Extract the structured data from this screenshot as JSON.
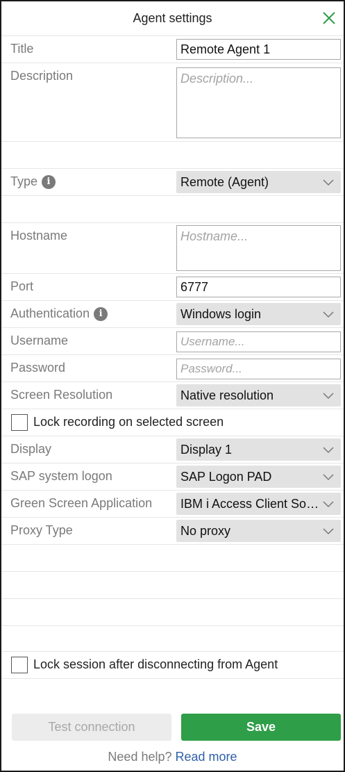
{
  "header": {
    "title": "Agent settings",
    "close_icon": "close-icon"
  },
  "fields": {
    "title": {
      "label": "Title",
      "value": "Remote Agent 1"
    },
    "description": {
      "label": "Description",
      "placeholder": "Description..."
    },
    "type": {
      "label": "Type",
      "value": "Remote (Agent)"
    },
    "hostname": {
      "label": "Hostname",
      "placeholder": "Hostname..."
    },
    "port": {
      "label": "Port",
      "value": "6777"
    },
    "authentication": {
      "label": "Authentication",
      "value": "Windows login"
    },
    "username": {
      "label": "Username",
      "placeholder": "Username..."
    },
    "password": {
      "label": "Password",
      "placeholder": "Password..."
    },
    "screen_resolution": {
      "label": "Screen Resolution",
      "value": "Native resolution"
    },
    "lock_recording": {
      "label": "Lock recording on selected screen",
      "checked": false
    },
    "display": {
      "label": "Display",
      "value": "Display 1"
    },
    "sap_logon": {
      "label": "SAP system logon",
      "value": "SAP Logon PAD"
    },
    "green_screen": {
      "label": "Green Screen Application",
      "value": "IBM i Access Client Solutions"
    },
    "proxy_type": {
      "label": "Proxy Type",
      "value": "No proxy"
    },
    "lock_session": {
      "label": "Lock session after disconnecting from Agent",
      "checked": false
    }
  },
  "info_icon_glyph": "i",
  "footer": {
    "test_label": "Test connection",
    "save_label": "Save",
    "help_text": "Need help?",
    "help_link": "Read more"
  },
  "colors": {
    "save": "#2e9e48",
    "link": "#2f5fa8",
    "close": "#2e9e48"
  }
}
